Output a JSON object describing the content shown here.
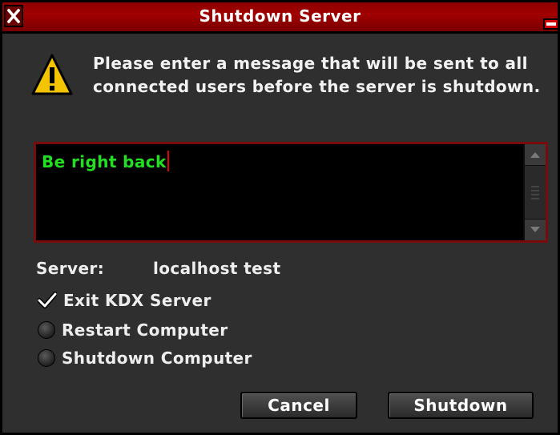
{
  "window": {
    "title": "Shutdown Server",
    "close_icon": "close-icon",
    "minimize_icon": "minimize-icon"
  },
  "prompt": {
    "icon": "warning-icon",
    "message": "Please enter a message that will be sent to all connected users before the server is shutdown."
  },
  "message_input": {
    "value": "Be right back"
  },
  "server": {
    "label": "Server:",
    "value": "localhost test"
  },
  "options": [
    {
      "label": "Exit KDX Server",
      "selected": true
    },
    {
      "label": "Restart Computer",
      "selected": false
    },
    {
      "label": "Shutdown Computer",
      "selected": false
    }
  ],
  "buttons": {
    "cancel": "Cancel",
    "shutdown": "Shutdown"
  },
  "colors": {
    "titlebar": "#a10000",
    "input_text": "#21e021",
    "input_border": "#7a0b0b",
    "background": "#2f2f2f"
  }
}
